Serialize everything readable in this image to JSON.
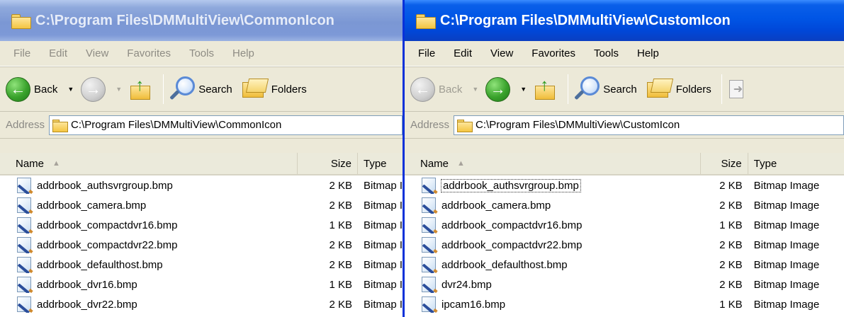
{
  "left_window": {
    "title": "C:\\Program Files\\DMMultiView\\CommonIcon",
    "menu": [
      "File",
      "Edit",
      "View",
      "Favorites",
      "Tools",
      "Help"
    ],
    "toolbar": {
      "back": "Back",
      "search": "Search",
      "folders": "Folders"
    },
    "address_label": "Address",
    "address_value": "C:\\Program Files\\DMMultiView\\CommonIcon",
    "columns": {
      "name": "Name",
      "size": "Size",
      "type": "Type"
    },
    "files": [
      {
        "name": "addrbook_authsvrgroup.bmp",
        "size": "2 KB",
        "type": "Bitmap Image"
      },
      {
        "name": "addrbook_camera.bmp",
        "size": "2 KB",
        "type": "Bitmap Image"
      },
      {
        "name": "addrbook_compactdvr16.bmp",
        "size": "1 KB",
        "type": "Bitmap Image"
      },
      {
        "name": "addrbook_compactdvr22.bmp",
        "size": "2 KB",
        "type": "Bitmap Image"
      },
      {
        "name": "addrbook_defaulthost.bmp",
        "size": "2 KB",
        "type": "Bitmap Image"
      },
      {
        "name": "addrbook_dvr16.bmp",
        "size": "1 KB",
        "type": "Bitmap Image"
      },
      {
        "name": "addrbook_dvr22.bmp",
        "size": "2 KB",
        "type": "Bitmap Image"
      }
    ]
  },
  "right_window": {
    "title": "C:\\Program Files\\DMMultiView\\CustomIcon",
    "menu": [
      "File",
      "Edit",
      "View",
      "Favorites",
      "Tools",
      "Help"
    ],
    "toolbar": {
      "back": "Back",
      "search": "Search",
      "folders": "Folders"
    },
    "address_label": "Address",
    "address_value": "C:\\Program Files\\DMMultiView\\CustomIcon",
    "columns": {
      "name": "Name",
      "size": "Size",
      "type": "Type"
    },
    "files": [
      {
        "name": "addrbook_authsvrgroup.bmp",
        "size": "2 KB",
        "type": "Bitmap Image"
      },
      {
        "name": "addrbook_camera.bmp",
        "size": "2 KB",
        "type": "Bitmap Image"
      },
      {
        "name": "addrbook_compactdvr16.bmp",
        "size": "1 KB",
        "type": "Bitmap Image"
      },
      {
        "name": "addrbook_compactdvr22.bmp",
        "size": "2 KB",
        "type": "Bitmap Image"
      },
      {
        "name": "addrbook_defaulthost.bmp",
        "size": "2 KB",
        "type": "Bitmap Image"
      },
      {
        "name": "dvr24.bmp",
        "size": "2 KB",
        "type": "Bitmap Image"
      },
      {
        "name": "ipcam16.bmp",
        "size": "1 KB",
        "type": "Bitmap Image"
      }
    ]
  },
  "colors": {
    "active_title": "#0055e5",
    "inactive_title": "#7b97d4",
    "chrome": "#ece9d8",
    "nav_green": "#3aa32c"
  }
}
